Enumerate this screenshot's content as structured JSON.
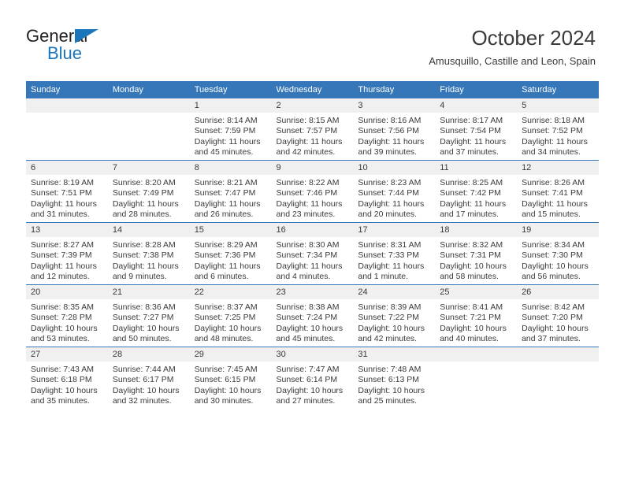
{
  "logo": {
    "word_top": "General",
    "word_bottom": "Blue",
    "triangle_color": "#1b75bb",
    "top_color": "#231f20"
  },
  "header": {
    "title": "October 2024",
    "subtitle": "Amusquillo, Castille and Leon, Spain"
  },
  "colors": {
    "header_blue": "#3577b9",
    "daynum_band": "#f0f0f0",
    "text": "#3a3a3a"
  },
  "calendar": {
    "weekday_headers": [
      "Sunday",
      "Monday",
      "Tuesday",
      "Wednesday",
      "Thursday",
      "Friday",
      "Saturday"
    ],
    "weeks": [
      [
        {
          "day": "",
          "sunrise": "",
          "sunset": "",
          "daylight1": "",
          "daylight2": ""
        },
        {
          "day": "",
          "sunrise": "",
          "sunset": "",
          "daylight1": "",
          "daylight2": ""
        },
        {
          "day": "1",
          "sunrise": "Sunrise: 8:14 AM",
          "sunset": "Sunset: 7:59 PM",
          "daylight1": "Daylight: 11 hours",
          "daylight2": "and 45 minutes."
        },
        {
          "day": "2",
          "sunrise": "Sunrise: 8:15 AM",
          "sunset": "Sunset: 7:57 PM",
          "daylight1": "Daylight: 11 hours",
          "daylight2": "and 42 minutes."
        },
        {
          "day": "3",
          "sunrise": "Sunrise: 8:16 AM",
          "sunset": "Sunset: 7:56 PM",
          "daylight1": "Daylight: 11 hours",
          "daylight2": "and 39 minutes."
        },
        {
          "day": "4",
          "sunrise": "Sunrise: 8:17 AM",
          "sunset": "Sunset: 7:54 PM",
          "daylight1": "Daylight: 11 hours",
          "daylight2": "and 37 minutes."
        },
        {
          "day": "5",
          "sunrise": "Sunrise: 8:18 AM",
          "sunset": "Sunset: 7:52 PM",
          "daylight1": "Daylight: 11 hours",
          "daylight2": "and 34 minutes."
        }
      ],
      [
        {
          "day": "6",
          "sunrise": "Sunrise: 8:19 AM",
          "sunset": "Sunset: 7:51 PM",
          "daylight1": "Daylight: 11 hours",
          "daylight2": "and 31 minutes."
        },
        {
          "day": "7",
          "sunrise": "Sunrise: 8:20 AM",
          "sunset": "Sunset: 7:49 PM",
          "daylight1": "Daylight: 11 hours",
          "daylight2": "and 28 minutes."
        },
        {
          "day": "8",
          "sunrise": "Sunrise: 8:21 AM",
          "sunset": "Sunset: 7:47 PM",
          "daylight1": "Daylight: 11 hours",
          "daylight2": "and 26 minutes."
        },
        {
          "day": "9",
          "sunrise": "Sunrise: 8:22 AM",
          "sunset": "Sunset: 7:46 PM",
          "daylight1": "Daylight: 11 hours",
          "daylight2": "and 23 minutes."
        },
        {
          "day": "10",
          "sunrise": "Sunrise: 8:23 AM",
          "sunset": "Sunset: 7:44 PM",
          "daylight1": "Daylight: 11 hours",
          "daylight2": "and 20 minutes."
        },
        {
          "day": "11",
          "sunrise": "Sunrise: 8:25 AM",
          "sunset": "Sunset: 7:42 PM",
          "daylight1": "Daylight: 11 hours",
          "daylight2": "and 17 minutes."
        },
        {
          "day": "12",
          "sunrise": "Sunrise: 8:26 AM",
          "sunset": "Sunset: 7:41 PM",
          "daylight1": "Daylight: 11 hours",
          "daylight2": "and 15 minutes."
        }
      ],
      [
        {
          "day": "13",
          "sunrise": "Sunrise: 8:27 AM",
          "sunset": "Sunset: 7:39 PM",
          "daylight1": "Daylight: 11 hours",
          "daylight2": "and 12 minutes."
        },
        {
          "day": "14",
          "sunrise": "Sunrise: 8:28 AM",
          "sunset": "Sunset: 7:38 PM",
          "daylight1": "Daylight: 11 hours",
          "daylight2": "and 9 minutes."
        },
        {
          "day": "15",
          "sunrise": "Sunrise: 8:29 AM",
          "sunset": "Sunset: 7:36 PM",
          "daylight1": "Daylight: 11 hours",
          "daylight2": "and 6 minutes."
        },
        {
          "day": "16",
          "sunrise": "Sunrise: 8:30 AM",
          "sunset": "Sunset: 7:34 PM",
          "daylight1": "Daylight: 11 hours",
          "daylight2": "and 4 minutes."
        },
        {
          "day": "17",
          "sunrise": "Sunrise: 8:31 AM",
          "sunset": "Sunset: 7:33 PM",
          "daylight1": "Daylight: 11 hours",
          "daylight2": "and 1 minute."
        },
        {
          "day": "18",
          "sunrise": "Sunrise: 8:32 AM",
          "sunset": "Sunset: 7:31 PM",
          "daylight1": "Daylight: 10 hours",
          "daylight2": "and 58 minutes."
        },
        {
          "day": "19",
          "sunrise": "Sunrise: 8:34 AM",
          "sunset": "Sunset: 7:30 PM",
          "daylight1": "Daylight: 10 hours",
          "daylight2": "and 56 minutes."
        }
      ],
      [
        {
          "day": "20",
          "sunrise": "Sunrise: 8:35 AM",
          "sunset": "Sunset: 7:28 PM",
          "daylight1": "Daylight: 10 hours",
          "daylight2": "and 53 minutes."
        },
        {
          "day": "21",
          "sunrise": "Sunrise: 8:36 AM",
          "sunset": "Sunset: 7:27 PM",
          "daylight1": "Daylight: 10 hours",
          "daylight2": "and 50 minutes."
        },
        {
          "day": "22",
          "sunrise": "Sunrise: 8:37 AM",
          "sunset": "Sunset: 7:25 PM",
          "daylight1": "Daylight: 10 hours",
          "daylight2": "and 48 minutes."
        },
        {
          "day": "23",
          "sunrise": "Sunrise: 8:38 AM",
          "sunset": "Sunset: 7:24 PM",
          "daylight1": "Daylight: 10 hours",
          "daylight2": "and 45 minutes."
        },
        {
          "day": "24",
          "sunrise": "Sunrise: 8:39 AM",
          "sunset": "Sunset: 7:22 PM",
          "daylight1": "Daylight: 10 hours",
          "daylight2": "and 42 minutes."
        },
        {
          "day": "25",
          "sunrise": "Sunrise: 8:41 AM",
          "sunset": "Sunset: 7:21 PM",
          "daylight1": "Daylight: 10 hours",
          "daylight2": "and 40 minutes."
        },
        {
          "day": "26",
          "sunrise": "Sunrise: 8:42 AM",
          "sunset": "Sunset: 7:20 PM",
          "daylight1": "Daylight: 10 hours",
          "daylight2": "and 37 minutes."
        }
      ],
      [
        {
          "day": "27",
          "sunrise": "Sunrise: 7:43 AM",
          "sunset": "Sunset: 6:18 PM",
          "daylight1": "Daylight: 10 hours",
          "daylight2": "and 35 minutes."
        },
        {
          "day": "28",
          "sunrise": "Sunrise: 7:44 AM",
          "sunset": "Sunset: 6:17 PM",
          "daylight1": "Daylight: 10 hours",
          "daylight2": "and 32 minutes."
        },
        {
          "day": "29",
          "sunrise": "Sunrise: 7:45 AM",
          "sunset": "Sunset: 6:15 PM",
          "daylight1": "Daylight: 10 hours",
          "daylight2": "and 30 minutes."
        },
        {
          "day": "30",
          "sunrise": "Sunrise: 7:47 AM",
          "sunset": "Sunset: 6:14 PM",
          "daylight1": "Daylight: 10 hours",
          "daylight2": "and 27 minutes."
        },
        {
          "day": "31",
          "sunrise": "Sunrise: 7:48 AM",
          "sunset": "Sunset: 6:13 PM",
          "daylight1": "Daylight: 10 hours",
          "daylight2": "and 25 minutes."
        },
        {
          "day": "",
          "sunrise": "",
          "sunset": "",
          "daylight1": "",
          "daylight2": ""
        },
        {
          "day": "",
          "sunrise": "",
          "sunset": "",
          "daylight1": "",
          "daylight2": ""
        }
      ]
    ]
  }
}
